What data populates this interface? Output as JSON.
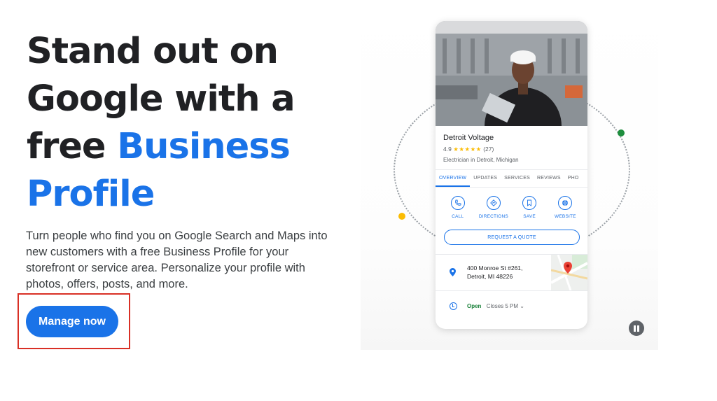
{
  "hero": {
    "title_line1": "Stand out on",
    "title_line2": "Google with a",
    "title_line3_plain": "free ",
    "title_line3_accent": "Business",
    "title_line4_accent": "Profile",
    "description": "Turn people who find you on Google Search and Maps into new customers with a free Business Profile for your storefront or service area. Personalize your profile with photos, offers, posts, and more.",
    "cta_label": "Manage now"
  },
  "profile_card": {
    "business_name": "Detroit Voltage",
    "rating": "4.9",
    "stars": "★★★★★",
    "review_count": "(27)",
    "category": "Electrician in Detroit, Michigan",
    "tabs": [
      {
        "label": "OVERVIEW",
        "active": true
      },
      {
        "label": "UPDATES",
        "active": false
      },
      {
        "label": "SERVICES",
        "active": false
      },
      {
        "label": "REVIEWS",
        "active": false
      },
      {
        "label": "PHO",
        "active": false
      }
    ],
    "actions": [
      {
        "label": "CALL",
        "icon": "phone-icon"
      },
      {
        "label": "DIRECTIONS",
        "icon": "directions-icon"
      },
      {
        "label": "SAVE",
        "icon": "bookmark-icon"
      },
      {
        "label": "WEBSITE",
        "icon": "globe-icon"
      }
    ],
    "quote_label": "REQUEST A QUOTE",
    "address_line1": "400 Monroe St #261,",
    "address_line2": "Detroit, MI 48226",
    "hours_status": "Open",
    "hours_detail": "Closes 5 PM",
    "hours_chevron": "⌄"
  },
  "colors": {
    "brand_blue": "#1a73e8",
    "highlight_red": "#d93025",
    "open_green": "#188038",
    "dot_green": "#1e8e3e",
    "dot_yellow": "#fbbc04"
  }
}
